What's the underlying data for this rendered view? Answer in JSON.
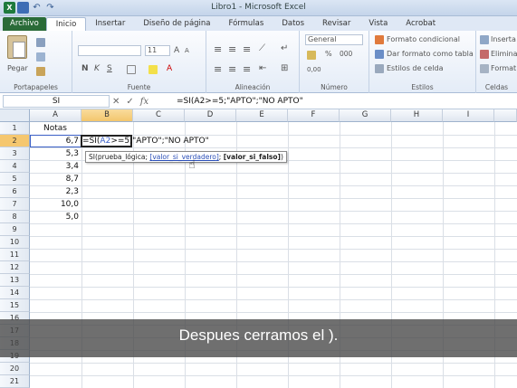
{
  "window": {
    "title": "Libro1 - Microsoft Excel"
  },
  "qat": {
    "logo": "X",
    "undo": "↶",
    "redo": "↷"
  },
  "tabs": [
    "Archivo",
    "Inicio",
    "Insertar",
    "Diseño de página",
    "Fórmulas",
    "Datos",
    "Revisar",
    "Vista",
    "Acrobat"
  ],
  "ribbon": {
    "groups": {
      "portapapeles": "Portapapeles",
      "fuente": "Fuente",
      "alineacion": "Alineación",
      "numero": "Número",
      "estilos": "Estilos",
      "celdas": "Celdas"
    },
    "paste_label": "Pegar",
    "font_size": "11",
    "bold": "N",
    "italic": "K",
    "underline": "S",
    "number_format": "General",
    "percent": "%",
    "thousands": "000",
    "decimals": "0,00",
    "cond_format": "Formato condicional",
    "table_format": "Dar formato como tabla",
    "cell_styles": "Estilos de celda",
    "insert": "Inserta",
    "delete": "Elimina",
    "format": "Format"
  },
  "formula_bar": {
    "name_box": "SI",
    "cancel": "✕",
    "enter": "✓",
    "fx": "fx",
    "formula": "=SI(A2>=5;\"APTO\";\"NO APTO\""
  },
  "columns": [
    "A",
    "B",
    "C",
    "D",
    "E",
    "F",
    "G",
    "H",
    "I"
  ],
  "rows": [
    "1",
    "2",
    "3",
    "4",
    "5",
    "6",
    "7",
    "8",
    "9",
    "10",
    "11",
    "12",
    "13",
    "14",
    "15",
    "16",
    "17",
    "18",
    "19",
    "20",
    "21"
  ],
  "cells": {
    "a1": "Notas",
    "a2": "6,7",
    "a3": "5,3",
    "a4": "3,4",
    "a5": "8,7",
    "a6": "2,3",
    "a7": "10,0",
    "a8": "5,0"
  },
  "editing": {
    "prefix": "=SI(",
    "ref": "A2",
    "suffix": ">=5;\"APTO\";\"NO APTO\""
  },
  "tooltip": {
    "fn": "SI(prueba_lógica;",
    "arg_link": "valor_si_verdadero",
    "sep": "; ",
    "arg_bold": "[valor_si_falso]",
    "close": ")"
  },
  "caption": "Despues cerramos el )."
}
